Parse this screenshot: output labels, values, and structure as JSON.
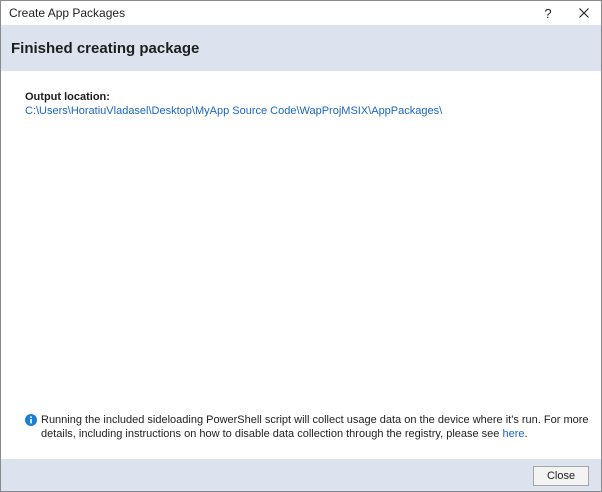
{
  "window": {
    "title": "Create App Packages",
    "help_label": "?",
    "close_icon": "close-icon"
  },
  "header": {
    "title": "Finished creating package"
  },
  "output": {
    "label": "Output location:",
    "path": "C:\\Users\\HoratiuVladasel\\Desktop\\MyApp Source Code\\WapProjMSIX\\AppPackages\\"
  },
  "info": {
    "icon": "info-icon",
    "text": "Running the included sideloading PowerShell script will collect usage data on the device where it's run.  For more details, including instructions on how to disable data collection through the registry, please see ",
    "link_text": "here",
    "tail": "."
  },
  "footer": {
    "close_label": "Close"
  },
  "colors": {
    "band": "#dde3ee",
    "link": "#1a66c4",
    "info_icon": "#1a7fd4"
  }
}
